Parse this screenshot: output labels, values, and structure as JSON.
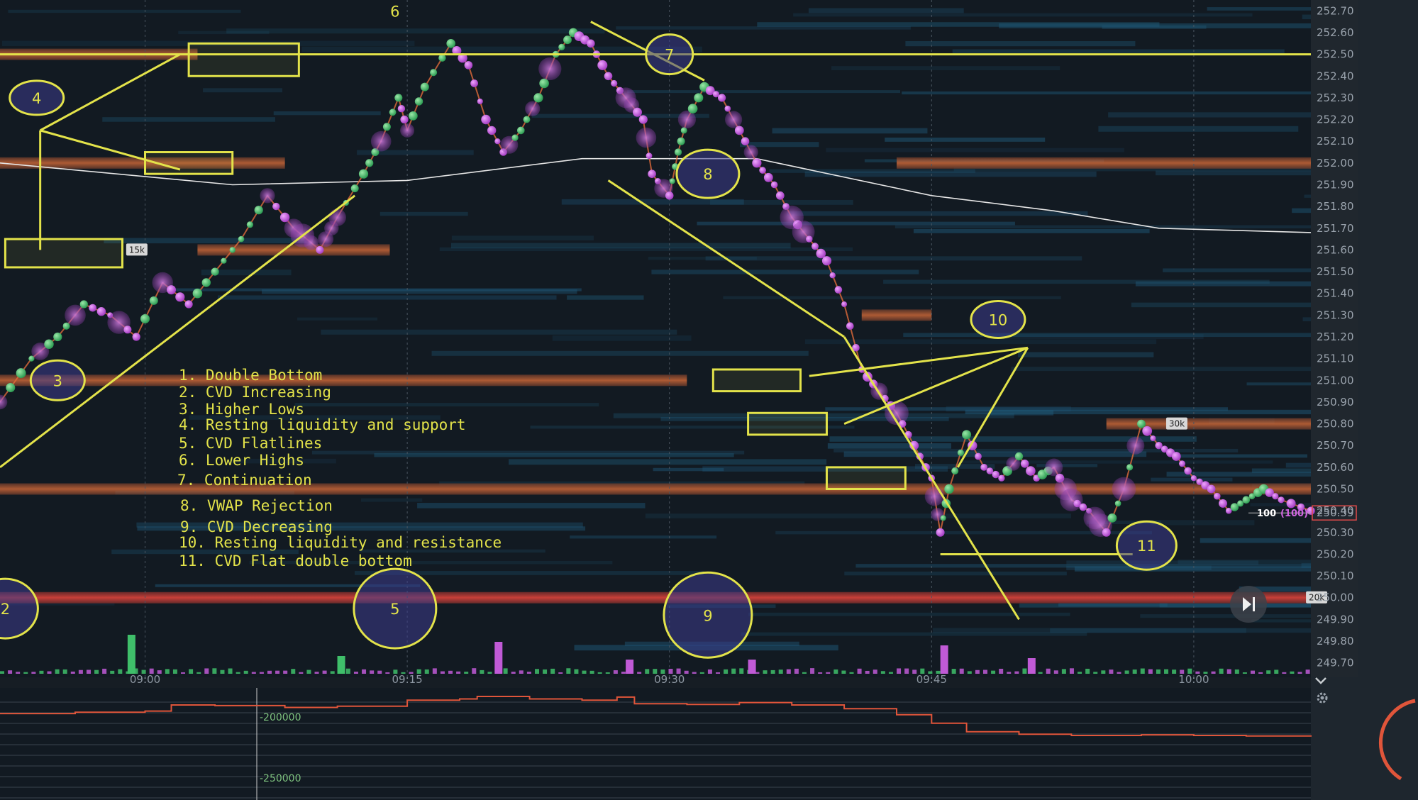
{
  "chart_data": [
    {
      "type": "line",
      "panel": "price heatmap",
      "price_axis": {
        "ticks": [
          "252.70",
          "252.60",
          "252.50",
          "252.40",
          "252.30",
          "252.20",
          "252.10",
          "252.00",
          "251.90",
          "251.80",
          "251.70",
          "251.60",
          "251.50",
          "251.40",
          "251.30",
          "251.20",
          "251.10",
          "251.00",
          "250.90",
          "250.80",
          "250.70",
          "250.60",
          "250.50",
          "250.40",
          "250.30",
          "250.20",
          "250.10",
          "250.00",
          "249.90",
          "249.80",
          "249.70"
        ],
        "range": [
          249.65,
          252.75
        ]
      },
      "time_axis": {
        "ticks": [
          "09:00",
          "09:15",
          "09:30",
          "09:45",
          "10:00"
        ],
        "range_minutes": [
          -8.3,
          66.7
        ]
      },
      "last_price": {
        "value": "250.39",
        "size_label": "100",
        "size_paren": "(100)"
      },
      "liquidity_tags": [
        {
          "label": "15k",
          "price": 251.6,
          "t": -1
        },
        {
          "label": "30k",
          "price": 250.8,
          "t": 58.5
        },
        {
          "label": "20k",
          "price": 250.0,
          "t": 66.5
        }
      ],
      "series": [
        {
          "kind": "price",
          "points": [
            [
              -8.3,
              250.9
            ],
            [
              -6.5,
              251.1
            ],
            [
              -5,
              251.2
            ],
            [
              -3.5,
              251.35
            ],
            [
              -2,
              251.3
            ],
            [
              -0.5,
              251.2
            ],
            [
              1,
              251.45
            ],
            [
              2.5,
              251.35
            ],
            [
              4,
              251.5
            ],
            [
              5.5,
              251.65
            ],
            [
              7,
              251.85
            ],
            [
              8.5,
              251.7
            ],
            [
              10,
              251.6
            ],
            [
              11,
              251.75
            ],
            [
              12.5,
              251.95
            ],
            [
              13.5,
              252.1
            ],
            [
              14.5,
              252.3
            ],
            [
              15,
              252.15
            ],
            [
              16,
              252.35
            ],
            [
              17.5,
              252.55
            ],
            [
              18.5,
              252.45
            ],
            [
              19.5,
              252.2
            ],
            [
              20.5,
              252.05
            ],
            [
              21.5,
              252.15
            ],
            [
              22.5,
              252.3
            ],
            [
              23.5,
              252.5
            ],
            [
              24.5,
              252.6
            ],
            [
              25.5,
              252.55
            ],
            [
              26.5,
              252.4
            ],
            [
              27.5,
              252.3
            ],
            [
              28.5,
              252.2
            ],
            [
              29,
              251.95
            ],
            [
              30,
              251.85
            ],
            [
              30.5,
              252.05
            ],
            [
              31,
              252.2
            ],
            [
              32,
              252.35
            ],
            [
              33,
              252.3
            ],
            [
              34,
              252.15
            ],
            [
              35,
              252.0
            ],
            [
              36,
              251.9
            ],
            [
              37,
              251.75
            ],
            [
              38,
              251.65
            ],
            [
              39,
              251.55
            ],
            [
              40,
              251.35
            ],
            [
              41,
              251.05
            ],
            [
              42,
              250.95
            ],
            [
              43,
              250.85
            ],
            [
              44,
              250.7
            ],
            [
              45,
              250.55
            ],
            [
              45.5,
              250.3
            ],
            [
              46,
              250.5
            ],
            [
              47,
              250.75
            ],
            [
              48,
              250.6
            ],
            [
              49,
              250.55
            ],
            [
              50,
              250.65
            ],
            [
              51,
              250.55
            ],
            [
              52,
              250.6
            ],
            [
              53,
              250.45
            ],
            [
              54,
              250.4
            ],
            [
              55,
              250.3
            ],
            [
              56,
              250.5
            ],
            [
              57,
              250.8
            ],
            [
              58,
              250.7
            ],
            [
              59,
              250.65
            ],
            [
              60,
              250.55
            ],
            [
              61,
              250.5
            ],
            [
              62,
              250.4
            ],
            [
              63,
              250.45
            ],
            [
              64,
              250.5
            ],
            [
              65,
              250.45
            ],
            [
              66.7,
              250.4
            ]
          ]
        },
        {
          "kind": "vwap",
          "points": [
            [
              -8.3,
              252.0
            ],
            [
              5,
              251.9
            ],
            [
              15,
              251.92
            ],
            [
              25,
              252.02
            ],
            [
              35,
              252.02
            ],
            [
              45,
              251.85
            ],
            [
              52,
              251.78
            ],
            [
              58,
              251.7
            ],
            [
              66.7,
              251.68
            ]
          ]
        },
        {
          "kind": "cvd",
          "points": [
            [
              -8.3,
              -197000
            ],
            [
              -4,
              -196000
            ],
            [
              0,
              -195000
            ],
            [
              1.5,
              -190000
            ],
            [
              4,
              -190500
            ],
            [
              8,
              -192000
            ],
            [
              11,
              -191000
            ],
            [
              15,
              -186000
            ],
            [
              18,
              -185000
            ],
            [
              19,
              -183000
            ],
            [
              22,
              -185000
            ],
            [
              25,
              -186000
            ],
            [
              27,
              -183500
            ],
            [
              28,
              -189000
            ],
            [
              31,
              -189500
            ],
            [
              34,
              -188000
            ],
            [
              37,
              -190000
            ],
            [
              40,
              -193000
            ],
            [
              43,
              -198000
            ],
            [
              45,
              -205000
            ],
            [
              47,
              -212000
            ],
            [
              50,
              -214000
            ],
            [
              53,
              -215000
            ],
            [
              57,
              -214500
            ],
            [
              60,
              -215000
            ],
            [
              63,
              -215500
            ],
            [
              66.7,
              -216000
            ]
          ]
        }
      ],
      "volume_bars": [
        {
          "t": -1,
          "value": 0.55,
          "color": "green"
        },
        {
          "t": 11,
          "value": 0.25,
          "color": "green"
        },
        {
          "t": 20,
          "value": 0.45,
          "color": "purple"
        },
        {
          "t": 27.5,
          "value": 0.2,
          "color": "purple"
        },
        {
          "t": 34.5,
          "value": 0.2,
          "color": "purple"
        },
        {
          "t": 45.5,
          "value": 0.4,
          "color": "purple"
        },
        {
          "t": 50.5,
          "value": 0.22,
          "color": "purple"
        }
      ]
    },
    {
      "type": "line",
      "panel": "CVD",
      "axis": {
        "ticks": [
          "-200000",
          "-250000"
        ],
        "range": [
          -268000,
          -176000
        ]
      }
    }
  ],
  "annotations": {
    "legend": [
      "1.  Double Bottom",
      "2.  CVD Increasing",
      "3.  Higher Lows",
      "4.  Resting liquidity and support",
      "5.  CVD Flatlines",
      "6.  Lower Highs",
      "7.  Continuation",
      "8.  VWAP Rejection",
      "9.  CVD Decreasing",
      "10.  Resting liquidity and resistance",
      "11.  CVD Flat double bottom"
    ],
    "callouts": [
      "2",
      "3",
      "4",
      "5",
      "6",
      "7",
      "8",
      "9",
      "10",
      "11"
    ]
  },
  "colors": {
    "background": "#121a22",
    "annotation": "#e3e34a",
    "buy": "#3fbf6a",
    "sell": "#c05ad6",
    "vwap": "#e6e6e6",
    "cvd_line": "#e0553a",
    "resting_liquidity": "#d0623a"
  },
  "icons": {
    "skip_button": "skip-to-end-icon",
    "settings": "gear-icon",
    "collapse": "chevron-down-icon"
  }
}
